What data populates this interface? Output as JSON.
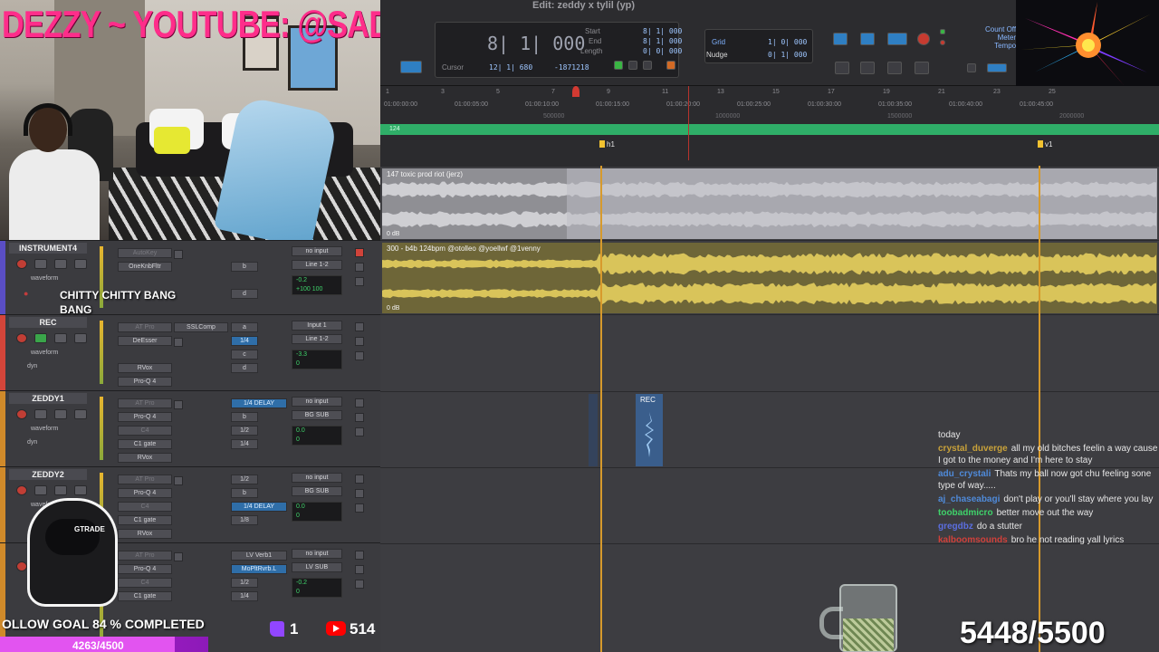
{
  "stream": {
    "title": "DEZZY ~ YOUTUBE: @SADEZZY",
    "follow_goal_text": "OLLOW GOAL 84 % COMPLETED",
    "follow_goal_percent": 84,
    "follow_goal_count": "4263/4500",
    "twitch_count": "1",
    "youtube_count": "514",
    "sub_goal": "5448/5500",
    "avatar_tag": "GTRADE",
    "now_playing_label": "CHITTY CHITTY BANG BANG"
  },
  "transport": {
    "window_title": "Edit: zeddy x tylil (yp)",
    "main_counter": "8| 1| 000",
    "labels": {
      "start": "Start",
      "end": "End",
      "length": "Length",
      "cursor": "Cursor",
      "grid": "Grid",
      "nudge": "Nudge",
      "count_off": "Count Off",
      "meter": "Meter",
      "tempo": "Tempo"
    },
    "values": {
      "start": "8| 1| 000",
      "end": "8| 1| 000",
      "length": "0| 0| 000",
      "cursor": "12| 1| 680",
      "cursor_samples": "-1871218",
      "grid": "1| 0| 000",
      "nudge": "0| 1| 000"
    }
  },
  "rulers": {
    "bars": [
      "1",
      "3",
      "5",
      "7",
      "9",
      "11",
      "13",
      "15",
      "17",
      "19",
      "21",
      "23",
      "25"
    ],
    "min_secs": [
      "01:00:00:00",
      "01:00:05:00",
      "01:00:10:00",
      "01:00:15:00",
      "01:00:20:00",
      "01:00:25:00",
      "01:00:30:00",
      "01:00:35:00",
      "01:00:40:00",
      "01:00:45:00"
    ],
    "samples": [
      "500000",
      "1000000",
      "1500000",
      "2000000"
    ],
    "tempo": "124",
    "markers": [
      {
        "label": "h1"
      },
      {
        "label": "v1"
      }
    ]
  },
  "tracks": [
    {
      "name": "INSTRUMENT4",
      "color": "#5a4ec4",
      "view": "waveform",
      "inserts": [
        "AutoKey",
        "OneKnbFltr",
        "",
        "",
        ""
      ],
      "sends": [
        "",
        "b",
        "",
        "d",
        ""
      ],
      "input": "no input",
      "output": "Line 1-2",
      "vol": "-0.2",
      "pan": "+100  100"
    },
    {
      "name": "REC",
      "color": "#d4453a",
      "view": "waveform",
      "auto": "dyn",
      "inserts": [
        "AT Pro",
        "DeEsser",
        "",
        "RVox",
        "Pro-Q 4"
      ],
      "inserts2": [
        "SSLComp",
        "",
        "",
        "",
        ""
      ],
      "sends": [
        "a",
        "1/4",
        "c",
        "d",
        ""
      ],
      "input": "Input 1",
      "output": "Line 1-2",
      "vol": "-3.3",
      "pan": "0"
    },
    {
      "name": "ZEDDY1",
      "color": "#d08a2a",
      "view": "waveform",
      "auto": "dyn",
      "inserts": [
        "AT Pro",
        "Pro-Q 4",
        "C4",
        "C1 gate",
        "RVox"
      ],
      "sends": [
        "1/4 DELAY",
        "b",
        "1/2",
        "1/4",
        ""
      ],
      "input": "no input",
      "output": "BG SUB",
      "vol": "0.0",
      "pan": "0"
    },
    {
      "name": "ZEDDY2",
      "color": "#d08a2a",
      "view": "waveform",
      "inserts": [
        "AT Pro",
        "Pro-Q 4",
        "C4",
        "C1 gate",
        "RVox"
      ],
      "sends": [
        "1/2",
        "b",
        "1/4 DELAY",
        "1/8",
        ""
      ],
      "input": "no input",
      "output": "BG SUB",
      "vol": "0.0",
      "pan": "0"
    },
    {
      "name": "",
      "color": "#d08a2a",
      "inserts": [
        "AT Pro",
        "Pro-Q 4",
        "C4",
        "C1 gate",
        ""
      ],
      "sends": [
        "LV Verb1",
        "MoPltRvrb.L",
        "1/2",
        "1/4",
        ""
      ],
      "input": "no input",
      "output": "LV SUB",
      "vol": "-0.2",
      "pan": "0"
    }
  ],
  "clips": [
    {
      "name": "147 toxic prod riot (jerz)",
      "gain": "0 dB",
      "color": "#a8a8ac"
    },
    {
      "name": "300 - b4b 124bpm @otolleo @yoellwf @1venny",
      "gain": "0 dB",
      "color": "#c9b54a"
    },
    {
      "name": "REC"
    }
  ],
  "chat": [
    {
      "user": "",
      "text": "today",
      "color": "#e6e6e6"
    },
    {
      "user": "crystal_duverge",
      "text": "all my old bitches feelin a way cause I got to the money and I'm here to stay",
      "color": "#c9a23a"
    },
    {
      "user": "adu_crystali",
      "text": "Thats my ball now got chu feeling sone type of way.....",
      "color": "#4f8ad9"
    },
    {
      "user": "aj_chaseabagi",
      "text": "don't play or you'll stay where you lay",
      "color": "#4f8ad9"
    },
    {
      "user": "toobadmicro",
      "text": "better move out the way",
      "color": "#3fd26a"
    },
    {
      "user": "gregdbz",
      "text": "do a stutter",
      "color": "#5b6ee0"
    },
    {
      "user": "kalboomsounds",
      "text": "bro he not reading yall lyrics",
      "color": "#d0403a"
    }
  ],
  "colors": {
    "stream_title": "#ff2d8a",
    "tempo_ruler": "#2fae68",
    "playhead": "#d79a2c",
    "follow_bar": "#c21bd6"
  }
}
